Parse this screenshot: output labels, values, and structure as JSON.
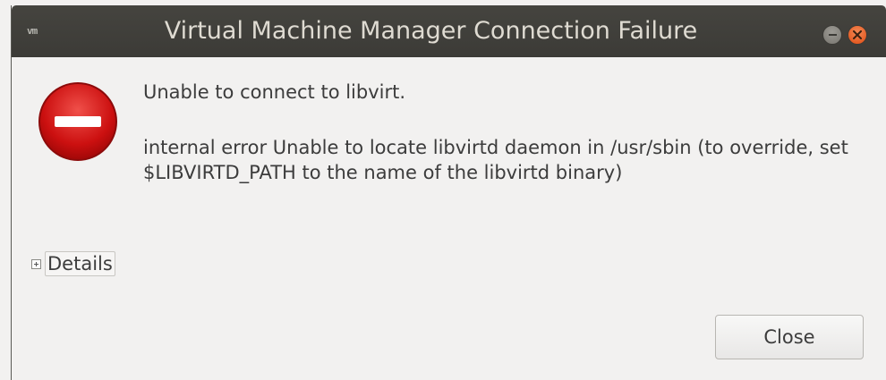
{
  "window": {
    "title": "Virtual Machine Manager Connection Failure",
    "app_icon_text": "vm"
  },
  "message": {
    "primary": "Unable to connect to libvirt.",
    "secondary": "internal error Unable to locate libvirtd daemon in /usr/sbin (to override, set $LIBVIRTD_PATH to the name of the libvirtd binary)"
  },
  "details": {
    "label": "Details",
    "expanded": false
  },
  "buttons": {
    "close_label": "Close"
  },
  "icons": {
    "error": "dialog-error-icon",
    "expander": "plus-icon",
    "minimize": "minimize-icon",
    "window_close": "close-icon"
  },
  "colors": {
    "titlebar": "#3c3b37",
    "error_red": "#d61a1a",
    "close_orange": "#df4b12"
  }
}
